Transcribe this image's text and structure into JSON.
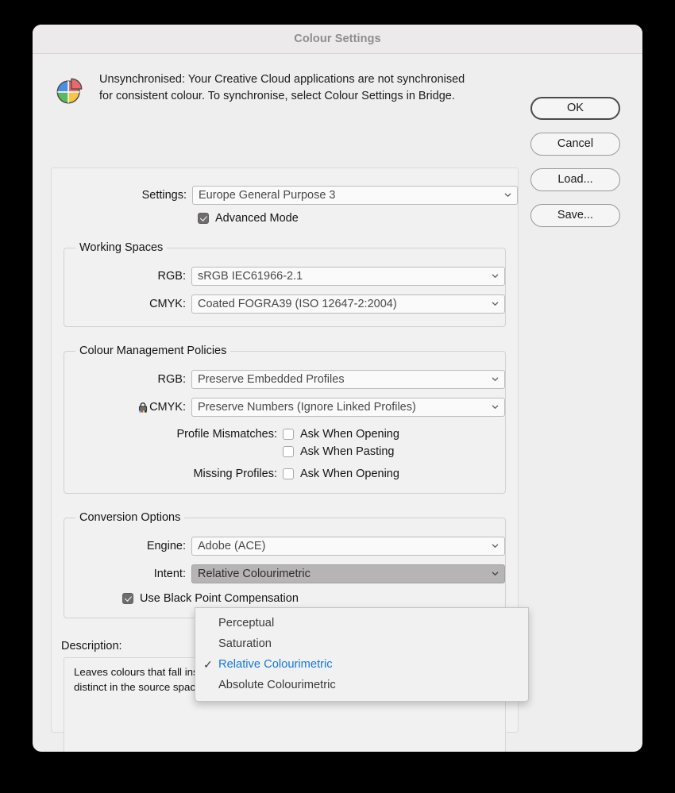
{
  "window": {
    "title": "Colour Settings"
  },
  "banner": {
    "icon": "colour-wheel-icon",
    "line1": "Unsynchronised: Your Creative Cloud applications are not synchronised",
    "line2": "for consistent colour. To synchronise, select Colour Settings in Bridge."
  },
  "buttons": {
    "ok": "OK",
    "cancel": "Cancel",
    "load": "Load...",
    "save": "Save..."
  },
  "settings": {
    "label": "Settings:",
    "value": "Europe General Purpose 3",
    "advanced_mode_label": "Advanced Mode",
    "advanced_mode_checked": true
  },
  "working_spaces": {
    "legend": "Working Spaces",
    "rgb_label": "RGB:",
    "rgb_value": "sRGB IEC61966‑2.1",
    "cmyk_label": "CMYK:",
    "cmyk_value": "Coated FOGRA39 (ISO 12647‑2:2004)"
  },
  "policies": {
    "legend": "Colour Management Policies",
    "rgb_label": "RGB:",
    "rgb_value": "Preserve Embedded Profiles",
    "cmyk_label": "CMYK:",
    "cmyk_icon": "lock-icon",
    "cmyk_value": "Preserve Numbers (Ignore Linked Profiles)",
    "profile_mismatches_label": "Profile Mismatches:",
    "ask_when_opening_1": "Ask When Opening",
    "ask_when_opening_1_checked": false,
    "ask_when_pasting": "Ask When Pasting",
    "ask_when_pasting_checked": false,
    "missing_profiles_label": "Missing Profiles:",
    "ask_when_opening_2": "Ask When Opening",
    "ask_when_opening_2_checked": false
  },
  "conversion": {
    "legend": "Conversion Options",
    "engine_label": "Engine:",
    "engine_value": "Adobe (ACE)",
    "intent_label": "Intent:",
    "intent_value": "Relative Colourimetric",
    "black_point_label": "Use Black Point Compensation",
    "black_point_checked": true
  },
  "intent_menu": {
    "open": true,
    "selected": "Relative Colourimetric",
    "check_glyph": "✓",
    "items": [
      {
        "label": "Perceptual",
        "selected": false
      },
      {
        "label": "Saturation",
        "selected": false
      },
      {
        "label": "Relative Colourimetric",
        "selected": true
      },
      {
        "label": "Absolute Colourimetric",
        "selected": false
      }
    ]
  },
  "description": {
    "label": "Description:",
    "text": "Leaves colours that fall inside the destination gamut unchanged. Two colours that are distinct in the source space may be mapped to the same colour in the destination space."
  },
  "colors": {
    "window_bg": "#efeeee",
    "panel_bg": "#f2f1f1",
    "accent_blue": "#1279e3",
    "title_text": "#8e8c8c",
    "pressed_select": "#b6b4b4"
  }
}
